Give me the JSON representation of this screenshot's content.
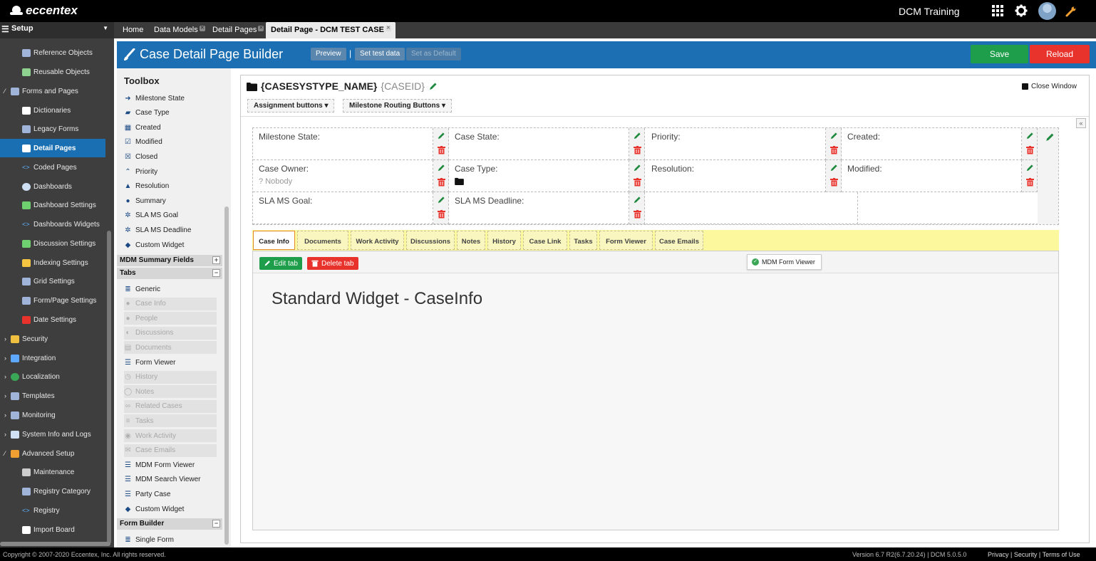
{
  "app": {
    "brand": "eccentex",
    "tenant": "DCM Training"
  },
  "topbar": {
    "icons": [
      "apps-grid-icon",
      "gear-icon",
      "user-avatar",
      "wrench-icon"
    ]
  },
  "nav": {
    "setup_label": "Setup",
    "tabs": [
      {
        "label": "Home"
      },
      {
        "label": "Data Models"
      },
      {
        "label": "Detail Pages"
      },
      {
        "label": "Detail Page - DCM TEST CASE"
      }
    ]
  },
  "sidebar": {
    "items": [
      {
        "label": "Reference Objects",
        "icon": "table-icon"
      },
      {
        "label": "Reusable Objects",
        "icon": "table-refresh-icon"
      },
      {
        "label": "Forms and Pages",
        "icon": "form-icon"
      },
      {
        "label": "Dictionaries",
        "icon": "document-icon"
      },
      {
        "label": "Legacy Forms",
        "icon": "form-icon"
      },
      {
        "label": "Detail Pages",
        "icon": "pages-icon"
      },
      {
        "label": "Coded Pages",
        "icon": "code-icon"
      },
      {
        "label": "Dashboards",
        "icon": "dashboard-icon"
      },
      {
        "label": "Dashboard Settings",
        "icon": "person-icon"
      },
      {
        "label": "Dashboards Widgets",
        "icon": "code-icon"
      },
      {
        "label": "Discussion Settings",
        "icon": "person-icon"
      },
      {
        "label": "Indexing Settings",
        "icon": "chart-icon"
      },
      {
        "label": "Grid Settings",
        "icon": "grid-icon"
      },
      {
        "label": "Form/Page Settings",
        "icon": "form-icon"
      },
      {
        "label": "Date Settings",
        "icon": "calendar-icon"
      },
      {
        "label": "Security",
        "icon": "lock-icon"
      },
      {
        "label": "Integration",
        "icon": "plug-icon"
      },
      {
        "label": "Localization",
        "icon": "globe-icon"
      },
      {
        "label": "Templates",
        "icon": "template-icon"
      },
      {
        "label": "Monitoring",
        "icon": "monitor-icon"
      },
      {
        "label": "System Info and Logs",
        "icon": "terminal-icon"
      },
      {
        "label": "Advanced Setup",
        "icon": "wrench-icon"
      },
      {
        "label": "Maintenance",
        "icon": "gears-icon"
      },
      {
        "label": "Registry Category",
        "icon": "table-icon"
      },
      {
        "label": "Registry",
        "icon": "code-icon"
      },
      {
        "label": "Import Board",
        "icon": "board-icon"
      }
    ]
  },
  "header": {
    "title": "Case Detail Page Builder",
    "preview": "Preview",
    "set_test_data": "Set test data",
    "set_default": "Set as Default",
    "save": "Save",
    "reload": "Reload"
  },
  "toolbox": {
    "title": "Toolbox",
    "fields": [
      {
        "label": "Milestone State",
        "icon": "arrow-right-icon"
      },
      {
        "label": "Case Type",
        "icon": "folder-icon"
      },
      {
        "label": "Created",
        "icon": "calendar-icon"
      },
      {
        "label": "Modified",
        "icon": "calendar-check-icon"
      },
      {
        "label": "Closed",
        "icon": "calendar-x-icon"
      },
      {
        "label": "Priority",
        "icon": "chevron-up-icon"
      },
      {
        "label": "Resolution",
        "icon": "thumbs-up-icon"
      },
      {
        "label": "Summary",
        "icon": "info-icon"
      },
      {
        "label": "SLA MS Goal",
        "icon": "cog-icon"
      },
      {
        "label": "SLA MS Deadline",
        "icon": "cog-icon"
      },
      {
        "label": "Custom Widget",
        "icon": "tag-icon"
      }
    ],
    "mdm_section": "MDM Summary Fields",
    "tabs_section": "Tabs",
    "tab_items": [
      {
        "label": "Generic",
        "icon": "database-icon",
        "disabled": false
      },
      {
        "label": "Case Info",
        "icon": "info-icon",
        "disabled": true
      },
      {
        "label": "People",
        "icon": "person-icon",
        "disabled": true
      },
      {
        "label": "Discussions",
        "icon": "comments-icon",
        "disabled": true
      },
      {
        "label": "Documents",
        "icon": "document-icon",
        "disabled": true
      },
      {
        "label": "Form Viewer",
        "icon": "list-icon",
        "disabled": false
      },
      {
        "label": "History",
        "icon": "history-icon",
        "disabled": true
      },
      {
        "label": "Notes",
        "icon": "comment-icon",
        "disabled": true
      },
      {
        "label": "Related Cases",
        "icon": "link-icon",
        "disabled": true
      },
      {
        "label": "Tasks",
        "icon": "tasks-icon",
        "disabled": true
      },
      {
        "label": "Work Activity",
        "icon": "users-icon",
        "disabled": true
      },
      {
        "label": "Case Emails",
        "icon": "envelope-icon",
        "disabled": true
      },
      {
        "label": "MDM Form Viewer",
        "icon": "list-icon",
        "disabled": false
      },
      {
        "label": "MDM Search Viewer",
        "icon": "list-icon",
        "disabled": false
      },
      {
        "label": "Party Case",
        "icon": "list-icon",
        "disabled": false
      },
      {
        "label": "Custom Widget",
        "icon": "tag-icon",
        "disabled": false
      }
    ],
    "form_builder_section": "Form Builder",
    "form_items": [
      {
        "label": "Single Form",
        "icon": "database-icon"
      }
    ]
  },
  "canvas": {
    "title": "{CASESYSTYPE_NAME}",
    "subtitle": "{CASEID}",
    "close_window": "Close Window",
    "dropdowns": [
      "Assignment buttons",
      "Milestone Routing Buttons"
    ],
    "fields": [
      {
        "label": "Milestone State:",
        "value": ""
      },
      {
        "label": "Case State:",
        "value": ""
      },
      {
        "label": "Priority:",
        "value": ""
      },
      {
        "label": "Created:",
        "value": ""
      },
      {
        "label": "Case Owner:",
        "value": "Nobody"
      },
      {
        "label": "Case Type:",
        "value": ""
      },
      {
        "label": "Resolution:",
        "value": ""
      },
      {
        "label": "Modified:",
        "value": ""
      },
      {
        "label": "SLA MS Goal:",
        "value": ""
      },
      {
        "label": "SLA MS Deadline:",
        "value": ""
      }
    ],
    "tabs": [
      "Case Info",
      "Documents",
      "Work Activity",
      "Discussions",
      "Notes",
      "History",
      "Case Link",
      "Tasks",
      "Form Viewer",
      "Case Emails"
    ],
    "active_tab": "Case Info",
    "edit_tab": "Edit tab",
    "delete_tab": "Delete tab",
    "mdm_chip": "MDM Form Viewer",
    "widget_text": "Standard Widget - CaseInfo"
  },
  "footer": {
    "copyright": "Copyright © 2007-2020 Eccentex, Inc. All rights reserved.",
    "version": "Version  6.7 R2(6.7.20.24) | DCM 5.0.5.0",
    "links": [
      "Privacy",
      "Security",
      "Terms of Use"
    ]
  },
  "colors": {
    "accent": "#1b6fb2",
    "save": "#1e9e4a",
    "reload": "#e8332d",
    "tabs_bg": "#fbf89e",
    "sidebar_active": "#1a6fb3"
  }
}
